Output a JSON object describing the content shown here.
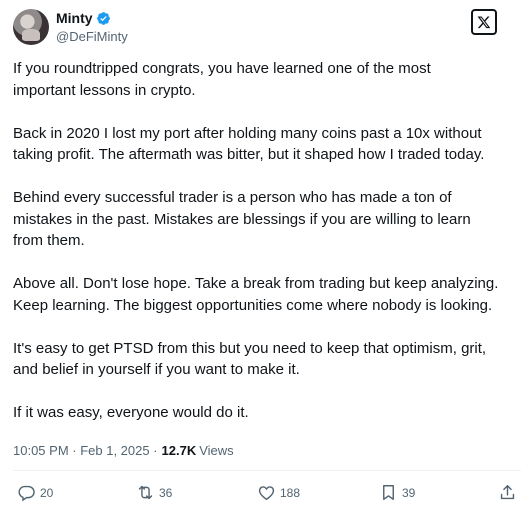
{
  "author": {
    "display_name": "Minty",
    "handle": "@DeFiMinty"
  },
  "tweet": {
    "paragraphs": [
      "If you roundtripped congrats, you have learned one of the most\nimportant lessons in crypto.",
      "Back in 2020 I lost my port after holding many coins past a 10x without\ntaking profit. The aftermath was bitter, but it shaped how I traded today.",
      "Behind every successful trader is a person who has made a ton of\nmistakes in the past. Mistakes are blessings if you are willing to learn\nfrom them.",
      "Above all. Don't lose hope. Take a break from trading but keep analyzing.\nKeep learning. The biggest opportunities come where nobody is looking.",
      "It's easy to get PTSD from this but you need to keep that optimism, grit,\nand belief in yourself if you want to make it.",
      "If it was easy, everyone would do it."
    ],
    "timestamp": "10:05 PM · Feb 1, 2025 ·",
    "views_count": "12.7K",
    "views_label": "Views"
  },
  "actions": {
    "replies": "20",
    "reposts": "36",
    "likes": "188",
    "bookmarks": "39"
  },
  "colors": {
    "text": "#0f1419",
    "secondary": "#536471",
    "verified": "#1d9bf0"
  },
  "icons": [
    "verified-badge-icon",
    "x-logo-icon",
    "reply-icon",
    "repost-icon",
    "like-icon",
    "bookmark-icon",
    "share-icon"
  ]
}
